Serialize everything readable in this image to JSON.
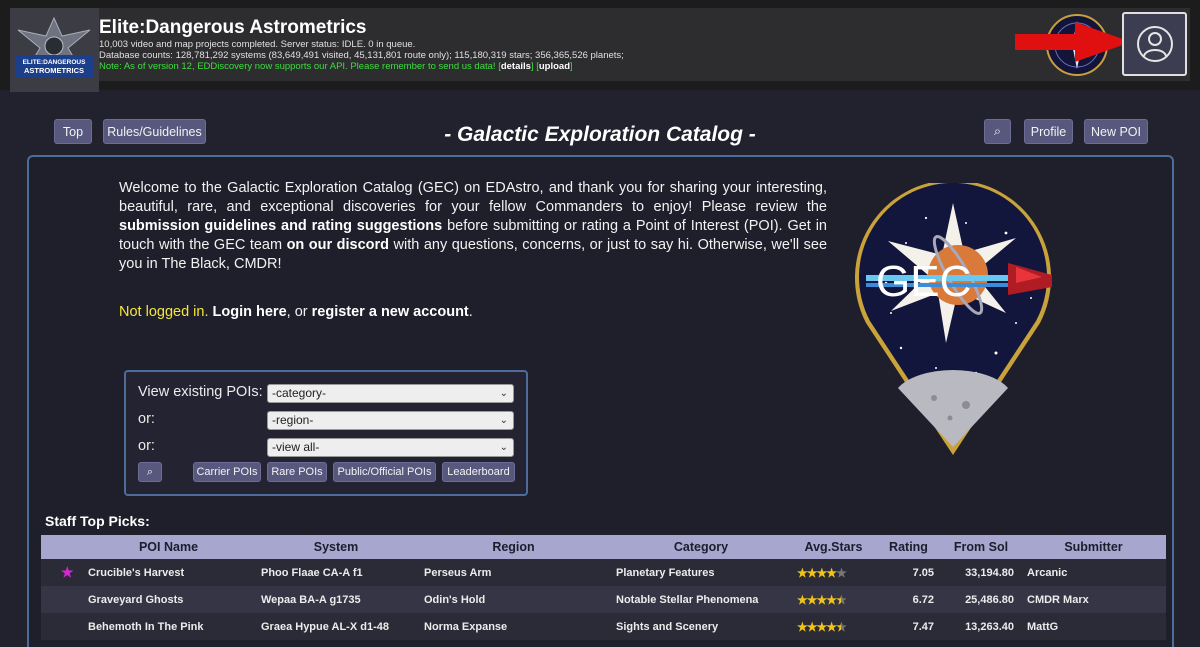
{
  "header": {
    "title": "Elite:Dangerous Astrometrics",
    "logo_text": "ELITE:DANGEROUS ASTROMETRICS",
    "line1": "10,003 video and map projects completed. Server status: IDLE. 0 in queue.",
    "line2": "Database counts: 128,781,292 systems (83,649,491 visited, 45,131,801 route only); 115,180,319 stars; 356,365,526 planets;",
    "line3_prefix": "Note: As of version 12, EDDiscovery now supports our API. Please remember to send us data! [",
    "details_link": "details",
    "line3_mid": "] [",
    "upload_link": "upload",
    "line3_suffix": "]"
  },
  "toolbar": {
    "top_label": "Top",
    "rules_label": "Rules/Guidelines",
    "page_title": "- Galactic Exploration Catalog -",
    "search_icon": "⌕",
    "profile_label": "Profile",
    "new_poi_label": "New POI"
  },
  "intro": {
    "p1": "Welcome to the Galactic Exploration Catalog (GEC) on EDAstro, and thank you for sharing your interesting, beautiful, rare, and exceptional discoveries for your fellow Commanders to enjoy! Please review the ",
    "link1": "submission guidelines and rating suggestions",
    "p2": " before submitting or rating a Point of Interest (POI). Get in touch with the GEC team ",
    "link2": "on our discord",
    "p3": " with any questions, concerns, or just to say hi. Otherwise, we'll see you in The Black, CMDR!"
  },
  "login": {
    "not_logged": "Not logged in.",
    "login_link": "Login here",
    "mid": ", or ",
    "register_link": "register a new account",
    "end": "."
  },
  "gec_logo_text": "GEC",
  "poi_form": {
    "label1": "View existing POIs:",
    "label2": "or:",
    "label3": "or:",
    "select1": "-category-",
    "select2": "-region-",
    "select3": "-view all-",
    "search_icon": "⌕",
    "carrier_label": "Carrier POIs",
    "rare_label": "Rare POIs",
    "public_label": "Public/Official POIs",
    "leaderboard_label": "Leaderboard"
  },
  "staff_picks": {
    "title": "Staff Top Picks:",
    "columns": [
      "POI Name",
      "System",
      "Region",
      "Category",
      "Avg.Stars",
      "Rating",
      "From Sol",
      "Submitter"
    ],
    "rows": [
      {
        "mark": "★",
        "name": "Crucible's Harvest",
        "system": "Phoo Flaae CA-A f1",
        "region": "Perseus Arm",
        "category": "Planetary Features",
        "stars": 4.0,
        "rating": "7.05",
        "from_sol": "33,194.80",
        "submitter": "Arcanic"
      },
      {
        "mark": "",
        "name": "Graveyard Ghosts",
        "system": "Wepaa BA-A g1735",
        "region": "Odin's Hold",
        "category": "Notable Stellar Phenomena",
        "stars": 4.5,
        "rating": "6.72",
        "from_sol": "25,486.80",
        "submitter": "CMDR Marx"
      },
      {
        "mark": "",
        "name": "Behemoth In The Pink",
        "system": "Graea Hypue AL-X d1-48",
        "region": "Norma Expanse",
        "category": "Sights and Scenery",
        "stars": 4.5,
        "rating": "7.47",
        "from_sol": "13,263.40",
        "submitter": "MattG"
      }
    ]
  },
  "colors": {
    "page_bg": "#22222e",
    "button_bg": "#58587e",
    "table_header_bg": "#a6a6cf",
    "row_dark": "#2b2b38",
    "row_light": "#353545",
    "highlight_yellow": "#f5e63a",
    "note_green": "#3adf3a",
    "star_gold": "#f0c419",
    "pick_mark": "#d02ad0",
    "arrow_red": "#e01010"
  },
  "icons": {
    "profile": "user-circle-icon",
    "search": "magnifier-icon",
    "chevron": "chevron-down-icon",
    "arrow": "red-arrow-icon"
  }
}
